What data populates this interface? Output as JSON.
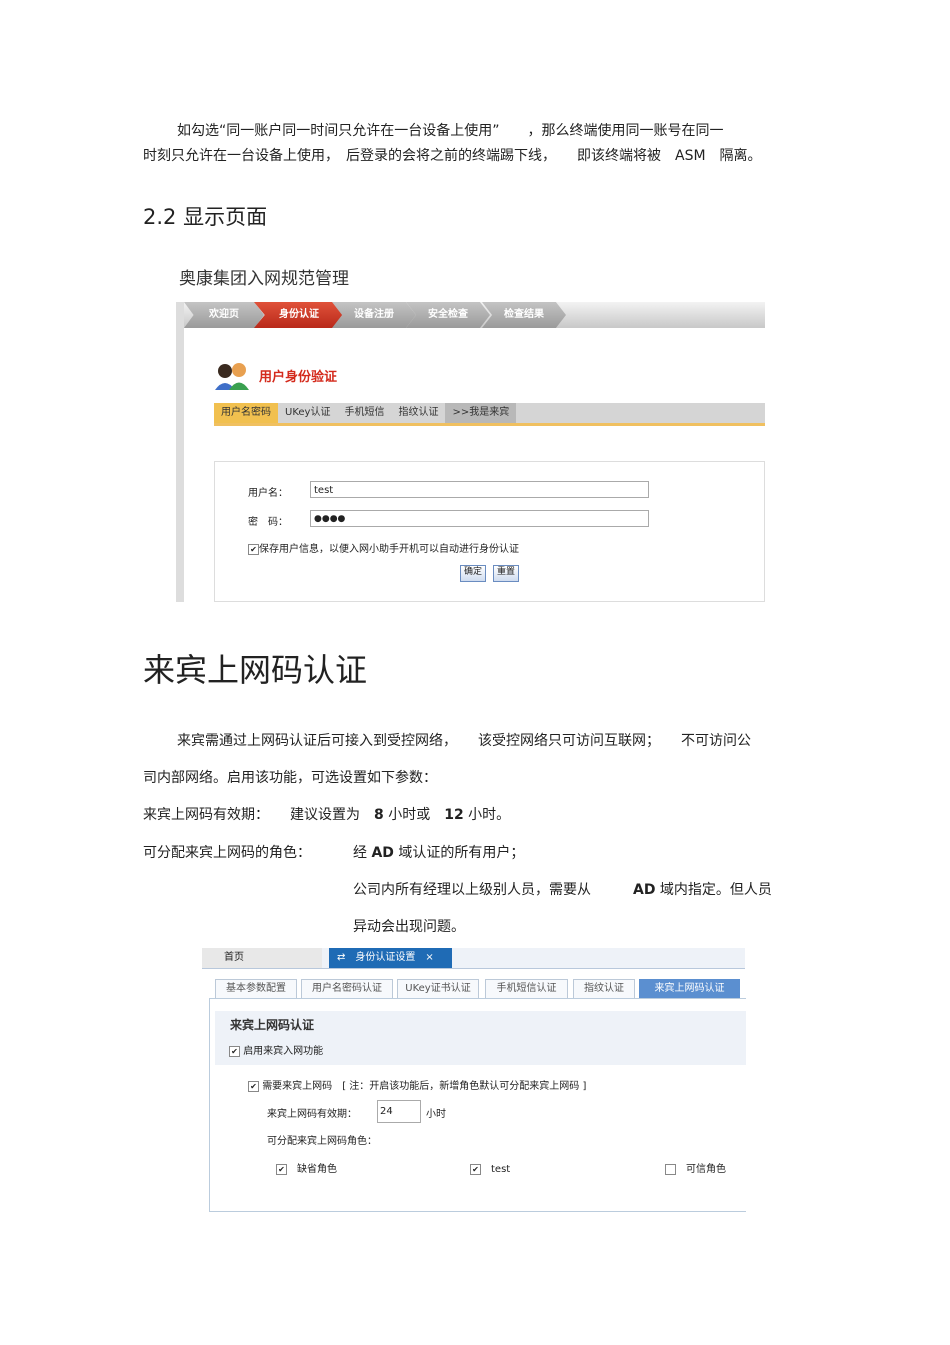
{
  "para1": {
    "line1": "如勾选“同一账户同一时间只允许在一台设备上使用”　　，那么终端使用同一账号在同一",
    "line2": "时刻只允许在一台设备上使用，　后登录的会将之前的终端踢下线，　　即该终端将被　ASM　隔离。"
  },
  "section_heading": "2.2  显示页面",
  "shot1": {
    "title": "奥康集团入网规范管理",
    "steps": [
      "欢迎页",
      "身份认证",
      "设备注册",
      "安全检查",
      "检查结果"
    ],
    "heading": "用户身份验证",
    "tabs": [
      "用户名密码",
      "UKey认证",
      "手机短信",
      "指纹认证",
      ">>我是来宾"
    ],
    "username_label": "用户名：",
    "username_value": "test",
    "password_label": "密　码：",
    "password_value": "●●●●",
    "save_label": "保存用户信息，以便入网小助手开机可以自动进行身份认证",
    "ok": "确定",
    "reset": "重置"
  },
  "big_heading": "来宾上网码认证",
  "body": {
    "l1": "来宾需通过上网码认证后可接入到受控网络，　　该受控网络只可访问互联网；　　不可访问公",
    "l2": "司内部网络。启用该功能，可选设置如下参数：",
    "l3a": "来宾上网码有效期：",
    "l3b": "建议设置为",
    "l3c": "8",
    "l3d": "小时或",
    "l3e": "12",
    "l3f": "小时。",
    "l4a": "可分配来宾上网码的角色：",
    "l4b": "经",
    "l4c": "AD",
    "l4d": "域认证的所有用户；",
    "l5a": "公司内所有经理以上级别人员，需要从",
    "l5b": "AD",
    "l5c": "域内指定。但人员",
    "l6": "异动会出现问题。"
  },
  "shot2": {
    "home_tab": "首页",
    "active_tab": "身份认证设置",
    "close": "×",
    "tabs": [
      "基本参数配置",
      "用户名密码认证",
      "UKey证书认证",
      "手机短信认证",
      "指纹认证",
      "来宾上网码认证"
    ],
    "section_title": "来宾上网码认证",
    "enable": "启用来宾入网功能",
    "require": "需要来宾上网码",
    "note": "[ 注：开启该功能后，新增角色默认可分配来宾上网码 ]",
    "validity_label": "来宾上网码有效期：",
    "validity_value": "24",
    "validity_unit": "小时",
    "roles_label": "可分配来宾上网码角色：",
    "roles": [
      {
        "name": "缺省角色",
        "checked": true
      },
      {
        "name": "test",
        "checked": true
      },
      {
        "name": "可信角色",
        "checked": false
      }
    ]
  }
}
